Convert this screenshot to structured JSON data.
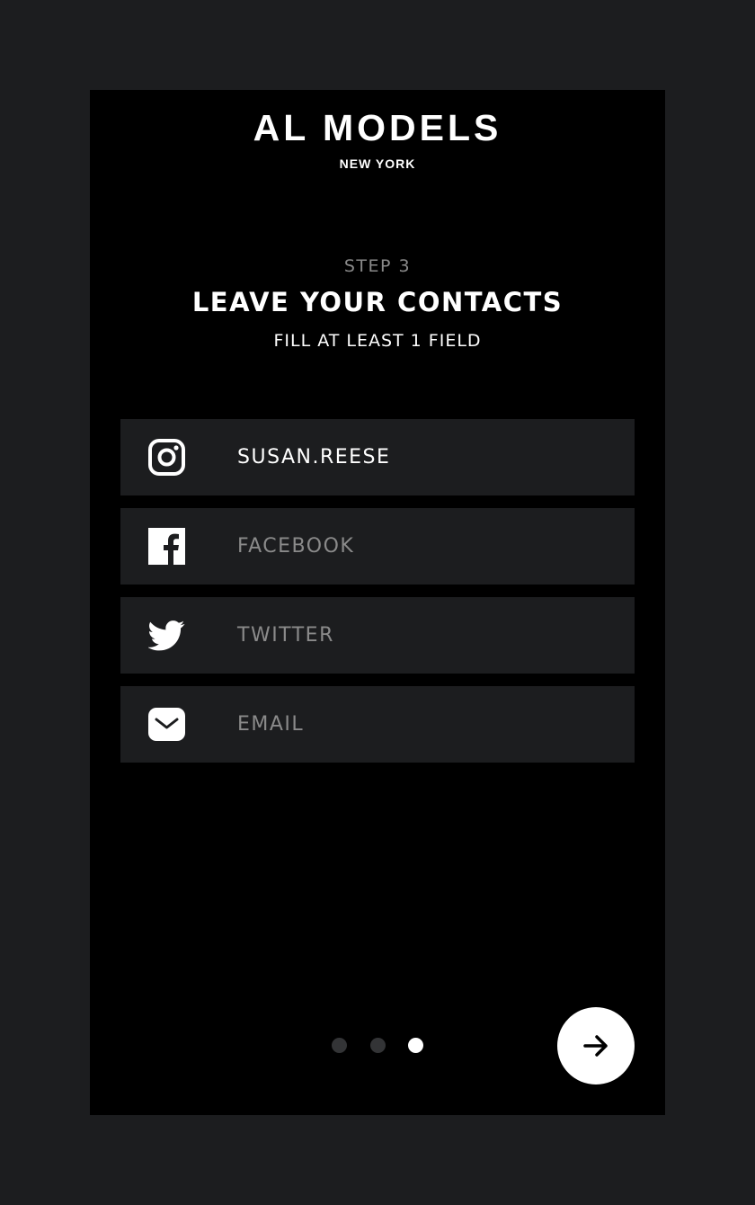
{
  "brand": {
    "name": "AL MODELS",
    "location": "NEW YORK"
  },
  "step": {
    "label": "STEP 3",
    "title": "LEAVE YOUR CONTACTS",
    "subtitle": "FILL AT LEAST 1 FIELD"
  },
  "fields": [
    {
      "icon": "instagram-icon",
      "value": "SUSAN.REESE",
      "placeholder": ""
    },
    {
      "icon": "facebook-icon",
      "value": "",
      "placeholder": "FACEBOOK"
    },
    {
      "icon": "twitter-icon",
      "value": "",
      "placeholder": "TWITTER"
    },
    {
      "icon": "email-icon",
      "value": "",
      "placeholder": "EMAIL"
    }
  ],
  "pagination": {
    "total": 3,
    "current": 3
  },
  "colors": {
    "background": "#1c1d1f",
    "screen": "#000000",
    "field": "#1c1d1f",
    "text": "#ffffff",
    "muted": "#8a8a8a",
    "dot_inactive": "#333436",
    "dot_active": "#ffffff"
  },
  "next_button": {
    "icon": "arrow-right-icon"
  }
}
